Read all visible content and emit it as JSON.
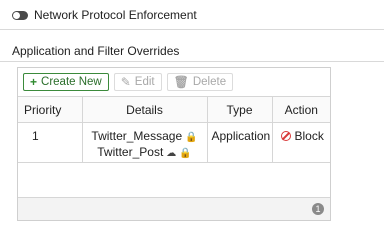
{
  "toggle": {
    "label": "Network Protocol Enforcement",
    "enabled": false
  },
  "section": {
    "title": "Application and Filter Overrides"
  },
  "toolbar": {
    "create_label": "Create New",
    "edit_label": "Edit",
    "delete_label": "Delete"
  },
  "table": {
    "headers": {
      "priority": "Priority",
      "details": "Details",
      "type": "Type",
      "action": "Action"
    },
    "rows": [
      {
        "priority": "1",
        "details": [
          "Twitter_Message",
          "Twitter_Post"
        ],
        "type": "Application",
        "action": "Block"
      }
    ]
  },
  "footer": {
    "count": "1"
  },
  "colors": {
    "create_accent": "#2f8a2f",
    "block": "#d93a3a",
    "toggle_off": "#4a4a4a"
  }
}
